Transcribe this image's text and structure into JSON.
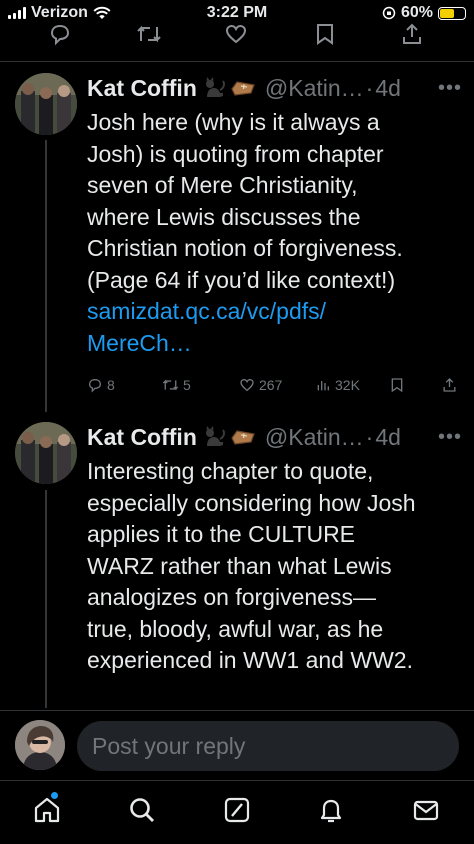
{
  "status_bar": {
    "carrier": "Verizon",
    "time": "3:22 PM",
    "battery_percent": "60%",
    "battery_level": 0.6
  },
  "tweets": [
    {
      "display_name": "Kat Coffin",
      "name_emoji": [
        "black-cat",
        "coffin"
      ],
      "handle": "@Katin…",
      "separator": "·",
      "time": "4d",
      "lines": [
        "Josh here (why is it always a",
        "Josh) is quoting from chapter",
        "seven of Mere Christianity,",
        "where Lewis discusses the",
        "Christian notion of forgiveness.",
        "(Page 64 if you’d like context!)"
      ],
      "link_lines": [
        "samizdat.qc.ca/vc/pdfs/",
        "MereCh…"
      ],
      "stats": {
        "replies": "8",
        "reposts": "5",
        "likes": "267",
        "views": "32K"
      }
    },
    {
      "display_name": "Kat Coffin",
      "name_emoji": [
        "black-cat",
        "coffin"
      ],
      "handle": "@Katin…",
      "separator": "·",
      "time": "4d",
      "lines": [
        "Interesting chapter to quote,",
        "especially considering how Josh",
        "applies it to the CULTURE",
        "WARZ rather than what Lewis",
        "analogizes on forgiveness—",
        "true, bloody, awful war, as he",
        "experienced in WW1 and WW2."
      ]
    }
  ],
  "reply": {
    "placeholder": "Post your reply"
  },
  "icons": {
    "top_actions": [
      "reply-icon",
      "repost-icon",
      "like-icon",
      "bookmark-icon",
      "share-icon"
    ],
    "tabs": [
      "home-icon",
      "search-icon",
      "grok-icon",
      "notifications-icon",
      "messages-icon"
    ]
  },
  "colors": {
    "link": "#1d9bf0",
    "muted": "#71767b",
    "background": "#000000",
    "text": "#e7e9ea"
  }
}
